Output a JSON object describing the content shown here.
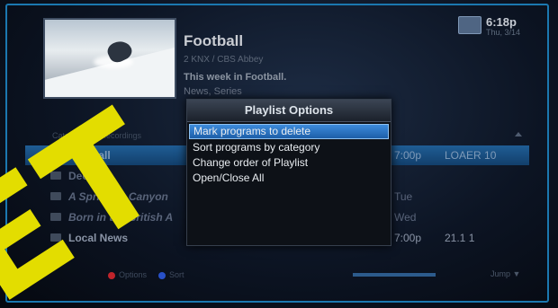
{
  "show": {
    "title": "Football",
    "channel": "2 KNX / CBS Abbey",
    "description": "This week in Football.",
    "genre": "News, Series"
  },
  "clock": {
    "time": "6:18p",
    "date": "Thu, 3/14"
  },
  "list": {
    "header": "Category: All Recordings",
    "rows": [
      {
        "name": "Football",
        "time": "7:00p",
        "channel": "LOAER 10",
        "italic": false
      },
      {
        "name": "Decode",
        "time": "",
        "channel": "",
        "italic": false
      },
      {
        "name": "A Spring in Canyon",
        "time": "Tue",
        "channel": "",
        "italic": true
      },
      {
        "name": "Born in the British A",
        "time": "Wed",
        "channel": "",
        "italic": true
      },
      {
        "name": "Local News",
        "time": "7:00p",
        "channel": "21.1 1",
        "italic": false
      }
    ]
  },
  "footer": {
    "red_label": "Options",
    "blue_label": "Sort",
    "right_text": "Jump ▼"
  },
  "modal": {
    "title": "Playlist Options",
    "options": [
      "Mark programs to delete",
      "Sort programs by category",
      "Change order of Playlist",
      "Open/Close All"
    ],
    "selected_index": 0
  },
  "watermark": {
    "text": "ET",
    "color": "#e3dd00"
  },
  "colors": {
    "accent": "#1b78b0",
    "highlight": "#3d8bdc",
    "red_button": "#c0242b",
    "blue_button": "#2850c8"
  }
}
